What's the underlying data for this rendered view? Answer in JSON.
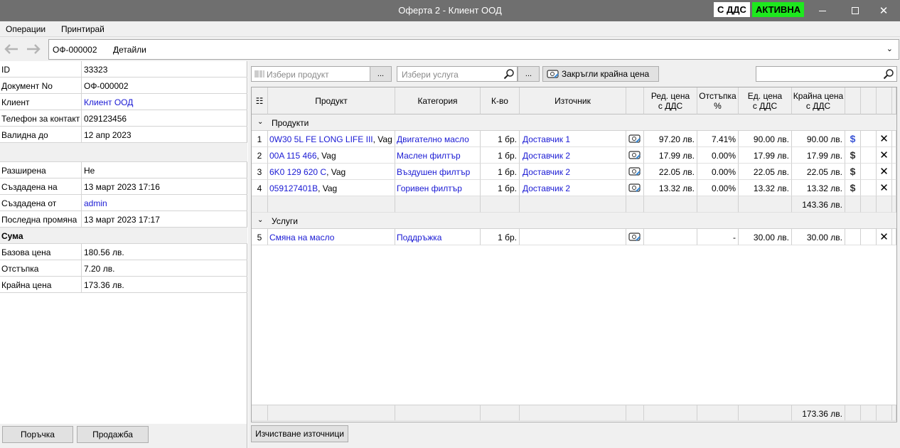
{
  "window": {
    "title": "Оферта 2 - Клиент ООД",
    "vat_badge": "С ДДС",
    "status_badge": "АКТИВНА",
    "status_color": "#1ee81e"
  },
  "menu": [
    "Операции",
    "Принтирай"
  ],
  "breadcrumb": {
    "doc": "ОФ-000002",
    "section": "Детайли"
  },
  "props": [
    {
      "label": "ID",
      "value": "33323",
      "link": false
    },
    {
      "label": "Документ No",
      "value": "ОФ-000002",
      "link": false
    },
    {
      "label": "Клиент",
      "value": "Клиент ООД",
      "link": true
    },
    {
      "label": "Телефон за контакт",
      "value": "029123456",
      "link": false
    },
    {
      "label": "Валидна до",
      "value": "12 апр 2023",
      "link": false
    },
    {
      "label": "Разширена",
      "value": "Не",
      "link": false
    },
    {
      "label": "Създадена на",
      "value": "13 март 2023 17:16",
      "link": false
    },
    {
      "label": "Създадена от",
      "value": "admin",
      "link": true
    },
    {
      "label": "Последна промяна",
      "value": "13 март 2023 17:17",
      "link": false
    }
  ],
  "sum_section": {
    "title": "Сума",
    "rows": [
      {
        "label": "Базова цена",
        "value": "180.56 лв."
      },
      {
        "label": "Отстъпка",
        "value": "7.20 лв."
      },
      {
        "label": "Крайна цена",
        "value": "173.36 лв."
      }
    ]
  },
  "left_buttons": {
    "order": "Поръчка",
    "sale": "Продажба"
  },
  "toolbar": {
    "product_placeholder": "Избери продукт",
    "service_placeholder": "Избери услуга",
    "ellipsis": "...",
    "round_button": "Закръгли крайна цена"
  },
  "columns": [
    "Продукт",
    "Категория",
    "К-во",
    "Източник",
    "Ред. цена\nс ДДС",
    "Отстъпка\n%",
    "Ед. цена\nс ДДС",
    "Крайна цена\nс ДДС"
  ],
  "groups": {
    "products": {
      "title": "Продукти",
      "rows": [
        {
          "n": "1",
          "code": "0W30 5L FE LONG LIFE III",
          "brand": ", Vag",
          "cat": "Двигателно масло",
          "qty": "1 бр.",
          "src": "Доставчик 1",
          "price": "97.20 лв.",
          "disc": "7.41%",
          "unit": "90.00 лв.",
          "final": "90.00 лв.",
          "dollar_blue": true
        },
        {
          "n": "2",
          "code": "00A 115 466",
          "brand": ", Vag",
          "cat": "Маслен филтър",
          "qty": "1 бр.",
          "src": "Доставчик 2",
          "price": "17.99 лв.",
          "disc": "0.00%",
          "unit": "17.99 лв.",
          "final": "17.99 лв.",
          "dollar_blue": false
        },
        {
          "n": "3",
          "code": "6K0 129 620 C",
          "brand": ", Vag",
          "cat": "Въздушен филтър",
          "qty": "1 бр.",
          "src": "Доставчик 2",
          "price": "22.05 лв.",
          "disc": "0.00%",
          "unit": "22.05 лв.",
          "final": "22.05 лв.",
          "dollar_blue": false
        },
        {
          "n": "4",
          "code": "059127401B",
          "brand": ", Vag",
          "cat": "Горивен филтър",
          "qty": "1 бр.",
          "src": "Доставчик 2",
          "price": "13.32 лв.",
          "disc": "0.00%",
          "unit": "13.32 лв.",
          "final": "13.32 лв.",
          "dollar_blue": false
        }
      ],
      "subtotal": "143.36 лв."
    },
    "services": {
      "title": "Услуги",
      "rows": [
        {
          "n": "5",
          "code": "Смяна на масло",
          "cat": "Поддръжка",
          "qty": "1 бр.",
          "disc": "-",
          "unit": "30.00 лв.",
          "final": "30.00 лв."
        }
      ]
    }
  },
  "grand_total": "173.36 лв.",
  "clear_sources_button": "Изчистване източници",
  "icons": {
    "dollar": "$",
    "remove": "✕",
    "back": "🡐",
    "forward": "🡒"
  }
}
